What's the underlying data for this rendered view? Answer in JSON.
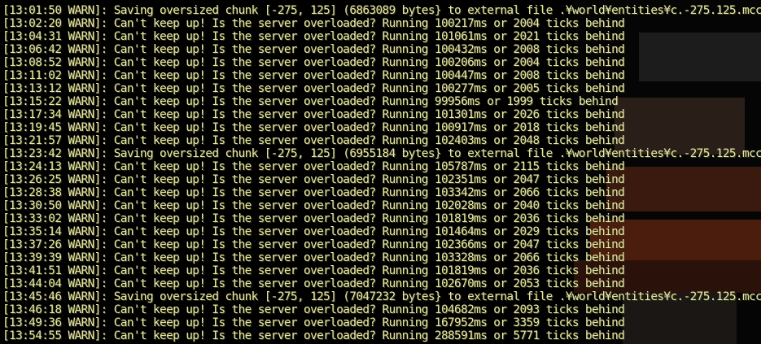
{
  "console": {
    "lines": [
      "[13:01:50 WARN]: Saving oversized chunk [-275, 125] (6863089 bytes} to external file .¥world¥entities¥c.-275.125.mcc",
      "[13:02:20 WARN]: Can't keep up! Is the server overloaded? Running 100217ms or 2004 ticks behind",
      "[13:04:31 WARN]: Can't keep up! Is the server overloaded? Running 101061ms or 2021 ticks behind",
      "[13:06:42 WARN]: Can't keep up! Is the server overloaded? Running 100432ms or 2008 ticks behind",
      "[13:08:52 WARN]: Can't keep up! Is the server overloaded? Running 100206ms or 2004 ticks behind",
      "[13:11:02 WARN]: Can't keep up! Is the server overloaded? Running 100447ms or 2008 ticks behind",
      "[13:13:12 WARN]: Can't keep up! Is the server overloaded? Running 100277ms or 2005 ticks behind",
      "[13:15:22 WARN]: Can't keep up! Is the server overloaded? Running 99956ms or 1999 ticks behind",
      "[13:17:34 WARN]: Can't keep up! Is the server overloaded? Running 101301ms or 2026 ticks behind",
      "[13:19:45 WARN]: Can't keep up! Is the server overloaded? Running 100917ms or 2018 ticks behind",
      "[13:21:57 WARN]: Can't keep up! Is the server overloaded? Running 102403ms or 2048 ticks behind",
      "[13:23:42 WARN]: Saving oversized chunk [-275, 125] (6955184 bytes} to external file .¥world¥entities¥c.-275.125.mcc",
      "[13:24:13 WARN]: Can't keep up! Is the server overloaded? Running 105787ms or 2115 ticks behind",
      "[13:26:25 WARN]: Can't keep up! Is the server overloaded? Running 102351ms or 2047 ticks behind",
      "[13:28:38 WARN]: Can't keep up! Is the server overloaded? Running 103342ms or 2066 ticks behind",
      "[13:30:50 WARN]: Can't keep up! Is the server overloaded? Running 102028ms or 2040 ticks behind",
      "[13:33:02 WARN]: Can't keep up! Is the server overloaded? Running 101819ms or 2036 ticks behind",
      "[13:35:14 WARN]: Can't keep up! Is the server overloaded? Running 101464ms or 2029 ticks behind",
      "[13:37:26 WARN]: Can't keep up! Is the server overloaded? Running 102366ms or 2047 ticks behind",
      "[13:39:39 WARN]: Can't keep up! Is the server overloaded? Running 103328ms or 2066 ticks behind",
      "[13:41:51 WARN]: Can't keep up! Is the server overloaded? Running 101819ms or 2036 ticks behind",
      "[13:44:04 WARN]: Can't keep up! Is the server overloaded? Running 102670ms or 2053 ticks behind",
      "[13:45:46 WARN]: Saving oversized chunk [-275, 125] (7047232 bytes} to external file .¥world¥entities¥c.-275.125.mcc",
      "[13:46:18 WARN]: Can't keep up! Is the server overloaded? Running 104682ms or 2093 ticks behind",
      "[13:49:36 WARN]: Can't keep up! Is the server overloaded? Running 167952ms or 3359 ticks behind",
      "[13:54:55 WARN]: Can't keep up! Is the server overloaded? Running 288591ms or 5771 ticks behind"
    ]
  },
  "colors": {
    "text": "#e8e8a8",
    "background": "#000000"
  }
}
